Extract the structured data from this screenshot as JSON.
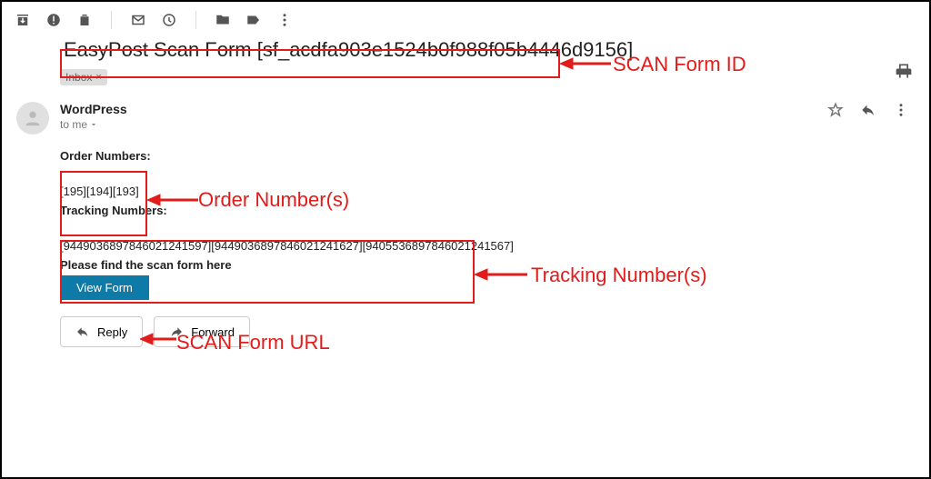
{
  "toolbar_icons": [
    "archive",
    "spam",
    "delete",
    "mark-unread",
    "snooze",
    "move",
    "label",
    "more"
  ],
  "subject": "EasyPost Scan Form [sf_acdfa903e1524b0f988f05b4446d9156]",
  "inbox_chip": "Inbox",
  "sender": {
    "name": "WordPress",
    "to_line": "to me"
  },
  "email_body": {
    "orders_label": "Order Numbers:",
    "orders_values": "[195][194][193]",
    "tracking_label": "Tracking Numbers:",
    "tracking_values": "[9449036897846021241597][9449036897846021241627][9405536897846021241567]",
    "hint": "Please find the scan form here",
    "button": "View Form"
  },
  "actions": {
    "reply": "Reply",
    "forward": "Forward"
  },
  "annotations": {
    "scan_form_id": "SCAN Form ID",
    "order_numbers": "Order Number(s)",
    "tracking_numbers": "Tracking Number(s)",
    "scan_form_url": "SCAN Form URL"
  }
}
